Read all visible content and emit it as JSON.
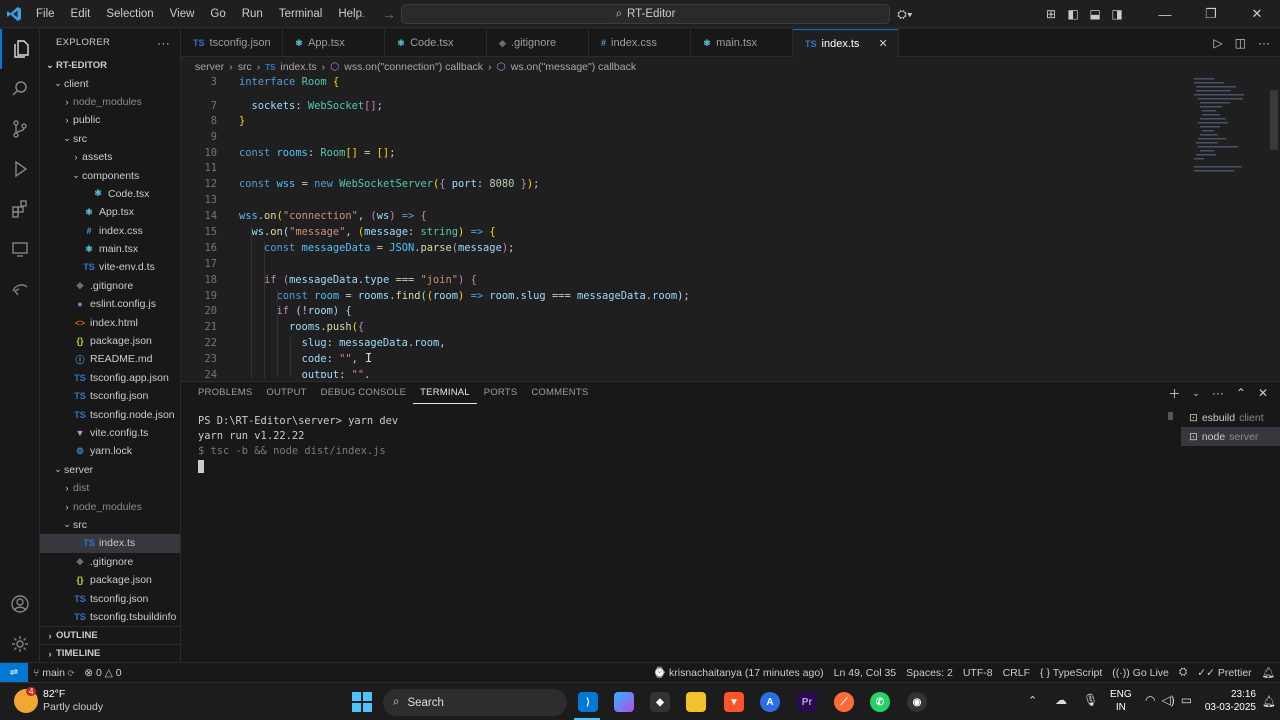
{
  "window": {
    "title": "RT-Editor",
    "menu": [
      "File",
      "Edit",
      "Selection",
      "View",
      "Go",
      "Run",
      "Terminal",
      "Help"
    ]
  },
  "explorer": {
    "header": "EXPLORER",
    "root": "RT-EDITOR",
    "items": [
      {
        "label": "client",
        "depth": 0,
        "type": "folder-open",
        "icon_color": ""
      },
      {
        "label": "node_modules",
        "depth": 1,
        "type": "folder",
        "dim": true
      },
      {
        "label": "public",
        "depth": 1,
        "type": "folder"
      },
      {
        "label": "src",
        "depth": 1,
        "type": "folder-open"
      },
      {
        "label": "assets",
        "depth": 2,
        "type": "folder"
      },
      {
        "label": "components",
        "depth": 2,
        "type": "folder-open"
      },
      {
        "label": "Code.tsx",
        "depth": 3,
        "type": "file",
        "icon": "⚛",
        "icon_color": "#61dafb"
      },
      {
        "label": "App.tsx",
        "depth": 2,
        "type": "file",
        "icon": "⚛",
        "icon_color": "#61dafb"
      },
      {
        "label": "index.css",
        "depth": 2,
        "type": "file",
        "icon": "#",
        "icon_color": "#569cd6"
      },
      {
        "label": "main.tsx",
        "depth": 2,
        "type": "file",
        "icon": "⚛",
        "icon_color": "#61dafb"
      },
      {
        "label": "vite-env.d.ts",
        "depth": 2,
        "type": "file",
        "icon": "TS",
        "icon_color": "#3178c6"
      },
      {
        "label": ".gitignore",
        "depth": 1,
        "type": "file",
        "icon": "◆",
        "icon_color": "#6e6e6e"
      },
      {
        "label": "eslint.config.js",
        "depth": 1,
        "type": "file",
        "icon": "●",
        "icon_color": "#8080f0"
      },
      {
        "label": "index.html",
        "depth": 1,
        "type": "file",
        "icon": "<>",
        "icon_color": "#e44d26"
      },
      {
        "label": "package.json",
        "depth": 1,
        "type": "file",
        "icon": "{}",
        "icon_color": "#cbcb41"
      },
      {
        "label": "README.md",
        "depth": 1,
        "type": "file",
        "icon": "ⓘ",
        "icon_color": "#519aba"
      },
      {
        "label": "tsconfig.app.json",
        "depth": 1,
        "type": "file",
        "icon": "TS",
        "icon_color": "#3178c6"
      },
      {
        "label": "tsconfig.json",
        "depth": 1,
        "type": "file",
        "icon": "TS",
        "icon_color": "#3178c6"
      },
      {
        "label": "tsconfig.node.json",
        "depth": 1,
        "type": "file",
        "icon": "TS",
        "icon_color": "#3178c6"
      },
      {
        "label": "vite.config.ts",
        "depth": 1,
        "type": "file",
        "icon": "▼",
        "icon_color": "#bd93f9"
      },
      {
        "label": "yarn.lock",
        "depth": 1,
        "type": "file",
        "icon": "⚙",
        "icon_color": "#2c8ebb"
      },
      {
        "label": "server",
        "depth": 0,
        "type": "folder-open"
      },
      {
        "label": "dist",
        "depth": 1,
        "type": "folder",
        "dim": true
      },
      {
        "label": "node_modules",
        "depth": 1,
        "type": "folder",
        "dim": true
      },
      {
        "label": "src",
        "depth": 1,
        "type": "folder-open"
      },
      {
        "label": "index.ts",
        "depth": 2,
        "type": "file",
        "icon": "TS",
        "icon_color": "#3178c6",
        "selected": true
      },
      {
        "label": ".gitignore",
        "depth": 1,
        "type": "file",
        "icon": "◆",
        "icon_color": "#6e6e6e"
      },
      {
        "label": "package.json",
        "depth": 1,
        "type": "file",
        "icon": "{}",
        "icon_color": "#cbcb41"
      },
      {
        "label": "tsconfig.json",
        "depth": 1,
        "type": "file",
        "icon": "TS",
        "icon_color": "#3178c6"
      },
      {
        "label": "tsconfig.tsbuildinfo",
        "depth": 1,
        "type": "file",
        "icon": "TS",
        "icon_color": "#3178c6"
      }
    ],
    "outline": "OUTLINE",
    "timeline": "TIMELINE"
  },
  "tabs": [
    {
      "label": "tsconfig.json",
      "icon": "TS",
      "icon_color": "#3178c6"
    },
    {
      "label": "App.tsx",
      "icon": "⚛",
      "icon_color": "#61dafb"
    },
    {
      "label": "Code.tsx",
      "icon": "⚛",
      "icon_color": "#61dafb"
    },
    {
      "label": ".gitignore",
      "icon": "◆",
      "icon_color": "#6e6e6e"
    },
    {
      "label": "index.css",
      "icon": "#",
      "icon_color": "#569cd6"
    },
    {
      "label": "main.tsx",
      "icon": "⚛",
      "icon_color": "#61dafb"
    },
    {
      "label": "index.ts",
      "icon": "TS",
      "icon_color": "#3178c6",
      "active": true
    }
  ],
  "breadcrumb": [
    "server",
    "src",
    "index.ts",
    "wss.on(\"connection\") callback",
    "ws.on(\"message\") callback"
  ],
  "editor": {
    "lines": [
      {
        "n": "3",
        "html": "<span class='kw'>interface</span> <span class='ty'>Room</span> <span class='br'>{</span>"
      },
      {
        "n": "7",
        "html": "  <span class='vr'>sockets</span>: <span class='ty'>WebSocket</span><span class='pu'>[]</span>;"
      },
      {
        "n": "8",
        "html": "<span class='br'>}</span>"
      },
      {
        "n": "9",
        "html": ""
      },
      {
        "n": "10",
        "html": "<span class='kw'>const</span> <span class='ct'>rooms</span>: <span class='ty'>Room</span><span class='br'>[]</span> = <span class='br'>[]</span>;"
      },
      {
        "n": "11",
        "html": ""
      },
      {
        "n": "12",
        "html": "<span class='kw'>const</span> <span class='ct'>wss</span> = <span class='kw'>new</span> <span class='ty'>WebSocketServer</span><span class='br'>(</span><span class='pu'>{</span> <span class='vr'>port</span>: <span class='nu'>8080</span> <span class='pu'>}</span><span class='br'>)</span>;"
      },
      {
        "n": "13",
        "html": ""
      },
      {
        "n": "14",
        "html": "<span class='ct'>wss</span>.<span class='fn'>on</span><span class='br'>(</span><span class='st'>\"connection\"</span>, <span class='pu'>(</span><span class='vr'>ws</span><span class='pu'>)</span> <span class='kw'>=&gt;</span> <span class='pu'>{</span>"
      },
      {
        "n": "15",
        "html": "  <span class='vr'>ws</span>.<span class='fn'>on</span><span class='vr'>(</span><span class='st'>\"message\"</span>, <span class='br'>(</span><span class='vr'>message</span>: <span class='ty'>string</span><span class='br'>)</span> <span class='kw'>=&gt;</span> <span class='br'>{</span>"
      },
      {
        "n": "16",
        "html": "    <span class='kw'>const</span> <span class='ct'>messageData</span> = <span class='ct'>JSON</span>.<span class='fn'>parse</span><span class='pu'>(</span><span class='vr'>message</span><span class='pu'>)</span>;"
      },
      {
        "n": "17",
        "html": ""
      },
      {
        "n": "18",
        "html": "    <span class='pu'>if</span> <span class='pu'>(</span><span class='vr'>messageData</span>.<span class='vr'>type</span> === <span class='st'>\"join\"</span><span class='pu'>)</span> <span class='pu'>{</span>"
      },
      {
        "n": "19",
        "html": "      <span class='kw'>const</span> <span class='ct'>room</span> = <span class='vr'>rooms</span>.<span class='fn'>find</span><span class='vr'>(</span><span class='br'>(</span><span class='vr'>room</span><span class='br'>)</span> <span class='kw'>=&gt;</span> <span class='vr'>room</span>.<span class='vr'>slug</span> === <span class='vr'>messageData</span>.<span class='vr'>room</span><span class='vr'>)</span>;"
      },
      {
        "n": "20",
        "html": "      <span class='pu'>if</span> <span class='vr'>(</span>!<span class='vr'>room</span><span class='vr'>)</span> <span class='vr'>{</span>"
      },
      {
        "n": "21",
        "html": "        <span class='vr'>rooms</span>.<span class='fn'>push</span><span class='br'>(</span><span class='pu'>{</span>"
      },
      {
        "n": "22",
        "html": "          <span class='vr'>slug</span>: <span class='vr'>messageData</span>.<span class='vr'>room</span>,"
      },
      {
        "n": "23",
        "html": "          <span class='vr'>code</span>: <span class='st'>\"\"</span>,"
      },
      {
        "n": "24",
        "html": "          <span class='vr'>output</span>: <span class='st'>\"\"</span>,"
      }
    ]
  },
  "panel": {
    "tabs": [
      "PROBLEMS",
      "OUTPUT",
      "DEBUG CONSOLE",
      "TERMINAL",
      "PORTS",
      "COMMENTS"
    ],
    "active_tab": "TERMINAL",
    "terminal_lines": [
      "PS D:\\RT-Editor\\server> yarn dev",
      "yarn run v1.22.22",
      "$ tsc -b && node dist/index.js"
    ],
    "terminals": [
      {
        "name": "esbuild",
        "sub": "client"
      },
      {
        "name": "node",
        "sub": "server",
        "active": true
      }
    ]
  },
  "statusbar": {
    "branch": "main",
    "errors": "0",
    "warnings": "0",
    "blame": "krisnachaitanya (17 minutes ago)",
    "position": "Ln 49, Col 35",
    "spaces": "Spaces: 2",
    "encoding": "UTF-8",
    "eol": "CRLF",
    "language": "TypeScript",
    "golive": "Go Live",
    "prettier": "Prettier"
  },
  "taskbar": {
    "weather_temp": "82°F",
    "weather_desc": "Partly cloudy",
    "search": "Search",
    "lang1": "ENG",
    "lang2": "IN",
    "time": "23:16",
    "date": "03-03-2025",
    "badge": "4"
  },
  "colors": {
    "accent": "#0078d4",
    "background": "#1f1f1f",
    "sidebar": "#181818"
  }
}
